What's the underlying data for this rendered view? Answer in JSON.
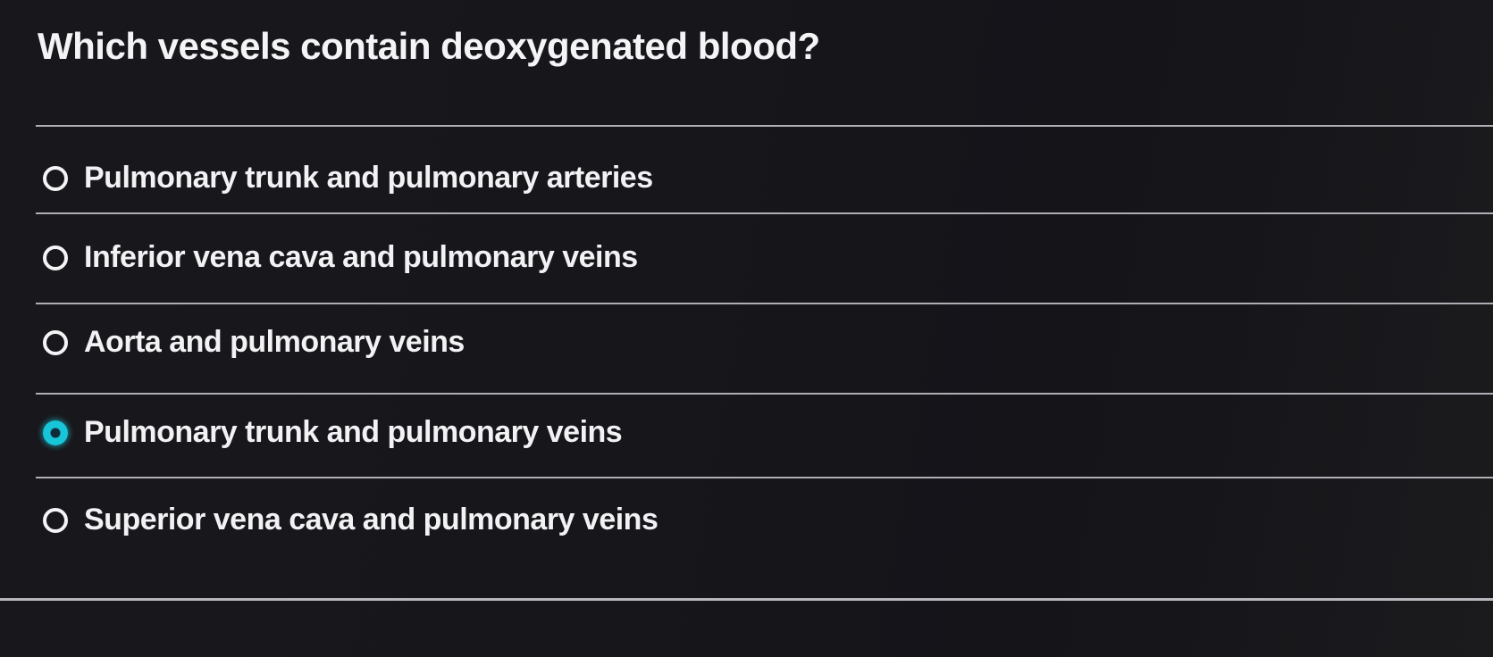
{
  "question": {
    "text": "Which vessels contain deoxygenated blood?"
  },
  "options": [
    {
      "label": "Pulmonary trunk and pulmonary arteries",
      "selected": false
    },
    {
      "label": "Inferior vena cava and pulmonary veins",
      "selected": false
    },
    {
      "label": "Aorta and pulmonary veins",
      "selected": false
    },
    {
      "label": "Pulmonary trunk and pulmonary veins",
      "selected": true
    },
    {
      "label": "Superior vena cava and pulmonary veins",
      "selected": false
    }
  ],
  "colors": {
    "background": "#16161b",
    "text": "#f2f2f4",
    "divider": "#c9c9cf",
    "selected_accent": "#18c4d8"
  }
}
